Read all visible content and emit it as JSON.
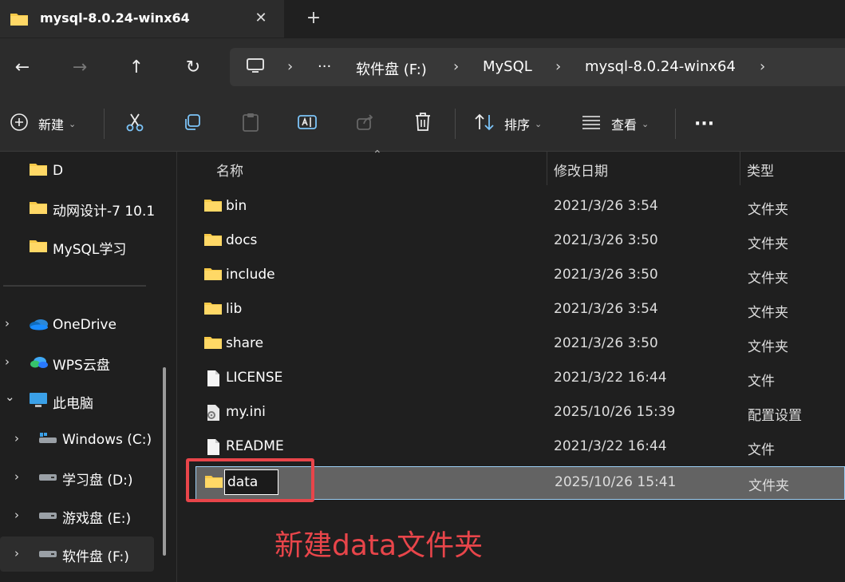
{
  "window": {
    "tab_title": "mysql-8.0.24-winx64",
    "tab_close": "✕",
    "new_tab": "+"
  },
  "nav": {
    "back": "←",
    "forward": "→",
    "up": "↑",
    "refresh": "↻"
  },
  "address": {
    "more": "···",
    "crumbs": [
      "软件盘 (F:)",
      "MySQL",
      "mysql-8.0.24-winx64"
    ],
    "sep": "›"
  },
  "toolbar": {
    "new_label": "新建",
    "sort_label": "排序",
    "view_label": "查看",
    "more_label": "···"
  },
  "sidebar": {
    "quick": [
      {
        "label": "D"
      },
      {
        "label": "动网设计-7 10.1"
      },
      {
        "label": "MySQL学习"
      }
    ],
    "tree": [
      {
        "label": "OneDrive",
        "chev": "›"
      },
      {
        "label": "WPS云盘",
        "chev": "›"
      },
      {
        "label": "此电脑",
        "chev": "⌄"
      },
      {
        "label": "Windows (C:)",
        "chev": "›"
      },
      {
        "label": "学习盘 (D:)",
        "chev": "›"
      },
      {
        "label": "游戏盘 (E:)",
        "chev": "›"
      },
      {
        "label": "软件盘 (F:)",
        "chev": "›"
      }
    ]
  },
  "list": {
    "headers": {
      "name": "名称",
      "date": "修改日期",
      "type": "类型"
    },
    "rows": [
      {
        "name": "bin",
        "date": "2021/3/26 3:54",
        "type": "文件夹",
        "icon": "folder-icon"
      },
      {
        "name": "docs",
        "date": "2021/3/26 3:50",
        "type": "文件夹",
        "icon": "folder-icon"
      },
      {
        "name": "include",
        "date": "2021/3/26 3:50",
        "type": "文件夹",
        "icon": "folder-icon"
      },
      {
        "name": "lib",
        "date": "2021/3/26 3:54",
        "type": "文件夹",
        "icon": "folder-icon"
      },
      {
        "name": "share",
        "date": "2021/3/26 3:50",
        "type": "文件夹",
        "icon": "folder-icon"
      },
      {
        "name": "LICENSE",
        "date": "2021/3/22 16:44",
        "type": "文件",
        "icon": "file-icon"
      },
      {
        "name": "my.ini",
        "date": "2025/10/26 15:39",
        "type": "配置设置",
        "icon": "config-file-icon"
      },
      {
        "name": "README",
        "date": "2021/3/22 16:44",
        "type": "文件",
        "icon": "file-icon"
      }
    ],
    "new_row": {
      "name": "data",
      "date": "2025/10/26 15:41",
      "type": "文件夹"
    }
  },
  "annotation": {
    "text": "新建data文件夹",
    "color": "#e8454a"
  },
  "colors": {
    "folder": "#f7c948",
    "selection_border": "#9ccff5"
  }
}
